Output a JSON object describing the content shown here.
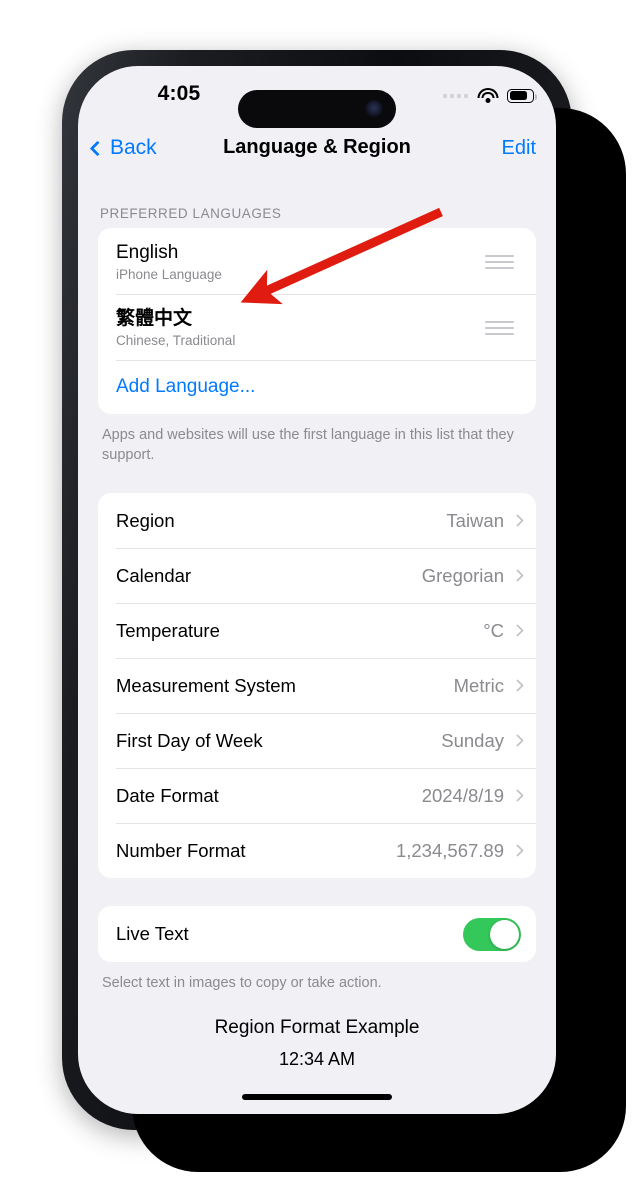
{
  "status_bar": {
    "time": "4:05",
    "cellular_icon": "cellular-dots-icon",
    "wifi_icon": "wifi-icon",
    "battery_icon": "battery-icon"
  },
  "nav": {
    "back_label": "Back",
    "back_icon": "chevron-left-icon",
    "title": "Language & Region",
    "edit_label": "Edit"
  },
  "preferred_languages": {
    "header": "PREFERRED LANGUAGES",
    "items": [
      {
        "name": "English",
        "subtitle": "iPhone Language",
        "handle_icon": "reorder-handle-icon"
      },
      {
        "name": "繁體中文",
        "subtitle": "Chinese, Traditional",
        "handle_icon": "reorder-handle-icon"
      }
    ],
    "add_language_label": "Add Language...",
    "footnote": "Apps and websites will use the first language in this list that they support."
  },
  "region_settings": {
    "rows": [
      {
        "label": "Region",
        "value": "Taiwan",
        "chevron_icon": "chevron-right-icon"
      },
      {
        "label": "Calendar",
        "value": "Gregorian",
        "chevron_icon": "chevron-right-icon"
      },
      {
        "label": "Temperature",
        "value": "°C",
        "chevron_icon": "chevron-right-icon"
      },
      {
        "label": "Measurement System",
        "value": "Metric",
        "chevron_icon": "chevron-right-icon"
      },
      {
        "label": "First Day of Week",
        "value": "Sunday",
        "chevron_icon": "chevron-right-icon"
      },
      {
        "label": "Date Format",
        "value": "2024/8/19",
        "chevron_icon": "chevron-right-icon"
      },
      {
        "label": "Number Format",
        "value": "1,234,567.89",
        "chevron_icon": "chevron-right-icon"
      }
    ]
  },
  "live_text": {
    "label": "Live Text",
    "toggle_state": "on",
    "footnote": "Select text in images to copy or take action."
  },
  "region_format_example": {
    "title": "Region Format Example",
    "time": "12:34 AM"
  },
  "annotation": {
    "arrow_color": "#e01b10",
    "arrow_target": "English language row"
  },
  "colors": {
    "accent_blue": "#007aff",
    "toggle_green": "#34c759",
    "screen_background": "#f0f0f5",
    "card_background": "#ffffff",
    "secondary_text": "#8a8a8f"
  }
}
